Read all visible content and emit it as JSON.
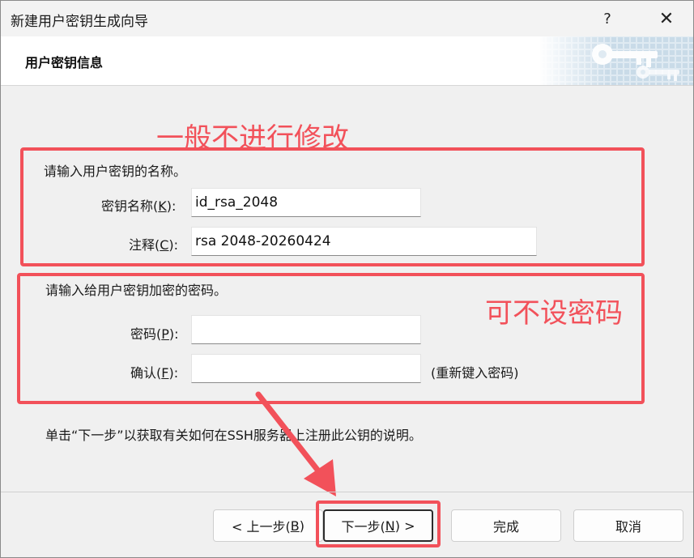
{
  "window": {
    "title": "新建用户密钥生成向导",
    "help_glyph": "?",
    "close_glyph": "✕"
  },
  "header": {
    "title": "用户密钥信息",
    "art_icon": "key-icon"
  },
  "key_section": {
    "prompt": "请输入用户密钥的名称。",
    "name_label_prefix": "密钥名称(",
    "name_label_key": "K",
    "name_label_suffix": "):",
    "name_value": "id_rsa_2048",
    "comment_label_prefix": "注释(",
    "comment_label_key": "C",
    "comment_label_suffix": "):",
    "comment_value": "rsa 2048-20260424"
  },
  "password_section": {
    "prompt": "请输入给用户密钥加密的密码。",
    "password_label_prefix": "密码(",
    "password_label_key": "P",
    "password_label_suffix": "):",
    "password_value": "",
    "confirm_label_prefix": "确认(",
    "confirm_label_key": "F",
    "confirm_label_suffix": "):",
    "confirm_value": "",
    "confirm_hint": "(重新键入密码)"
  },
  "info_text": "单击“下一步”以获取有关如何在SSH服务器上注册此公钥的说明。",
  "annotations": {
    "top_note": "一般不进行修改",
    "password_note": "可不设密码",
    "color": "#f2515a"
  },
  "buttons": {
    "back_prefix": "< 上一步(",
    "back_key": "B",
    "back_suffix": ")",
    "next_prefix": "下一步(",
    "next_key": "N",
    "next_suffix": ") >",
    "finish": "完成",
    "cancel": "取消"
  }
}
